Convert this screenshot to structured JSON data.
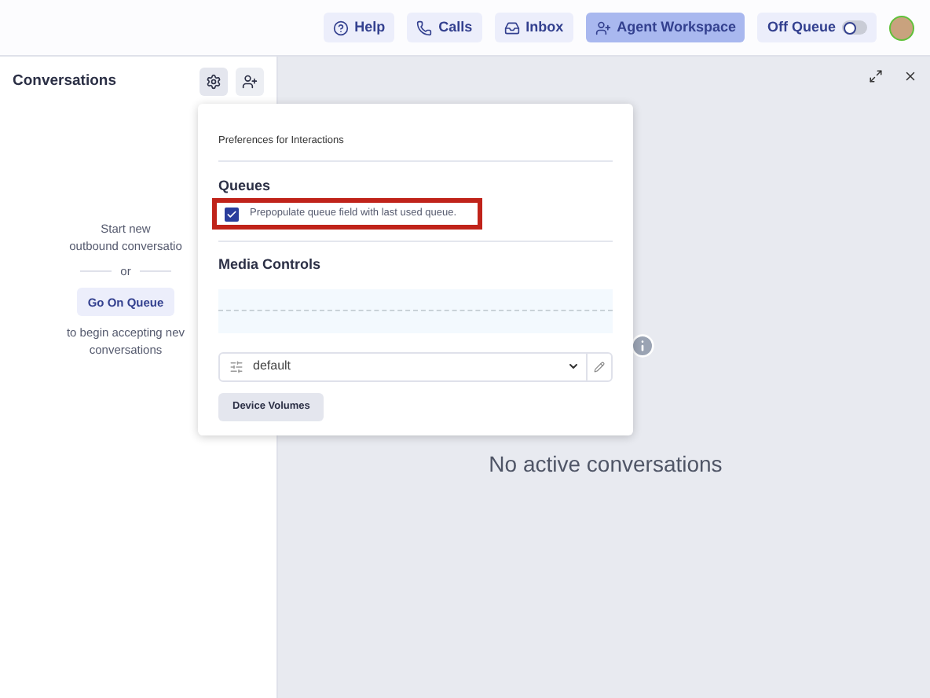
{
  "top_bar": {
    "nav": [
      {
        "label": "Help",
        "kind": "help",
        "selected": false
      },
      {
        "label": "Calls",
        "kind": "calls",
        "selected": false
      },
      {
        "label": "Inbox",
        "kind": "inbox",
        "selected": false
      },
      {
        "label": "Agent Workspace",
        "kind": "workspace",
        "selected": true
      }
    ],
    "queue_toggle": {
      "label": "Off Queue",
      "on": false
    }
  },
  "conversations_panel": {
    "title": "Conversations",
    "empty_lines": [
      "Start new",
      "outbound conversatio"
    ],
    "divider_text": "or",
    "button": "Go On Queue",
    "after_lines": [
      "to begin accepting nev",
      "conversations"
    ]
  },
  "preferences_popover": {
    "title": "Preferences for Interactions",
    "queues": {
      "heading": "Queues",
      "checkbox": {
        "label": "Prepopulate queue field with last used queue.",
        "checked": true,
        "highlighted": true
      }
    },
    "media_controls": {
      "heading": "Media Controls",
      "select_value": "default",
      "button": "Device Volumes"
    }
  },
  "workspace": {
    "empty_text": "No active conversations"
  }
}
